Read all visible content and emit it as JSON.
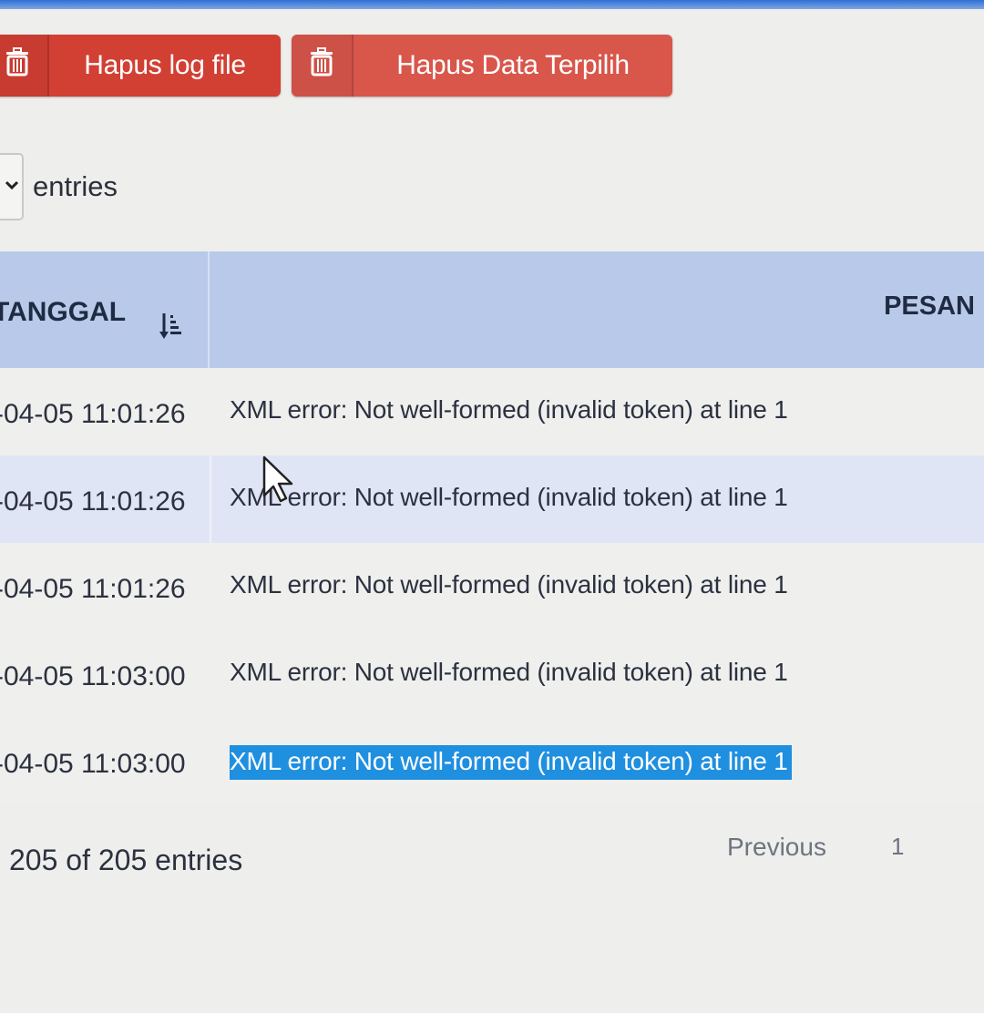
{
  "toolbar": {
    "delete_log_label": "Hapus log file",
    "delete_selected_label": "Hapus Data Terpilih",
    "danger_color": "#d23f33",
    "icon": "trash-icon"
  },
  "length_menu": {
    "suffix": "entries"
  },
  "table": {
    "columns": [
      "TANGGAL",
      "PESAN"
    ],
    "header_color": "#b9c9ea",
    "rows": [
      {
        "date": "-04-05 11:01:26",
        "message": "XML error: Not well-formed (invalid token) at line 1"
      },
      {
        "date": "-04-05 11:01:26",
        "message": "XML error: Not well-formed (invalid token) at line 1"
      },
      {
        "date": "-04-05 11:01:26",
        "message": "XML error: Not well-formed (invalid token) at line 1"
      },
      {
        "date": "-04-05 11:03:00",
        "message": "XML error: Not well-formed (invalid token) at line 1"
      },
      {
        "date": "-04-05 11:03:00",
        "message": "XML error: Not well-formed (invalid token) at line 1"
      }
    ]
  },
  "footer": {
    "info": "205 of 205 entries",
    "previous_label": "Previous",
    "page_label": "1"
  },
  "selection_color": "#1f8fe0"
}
